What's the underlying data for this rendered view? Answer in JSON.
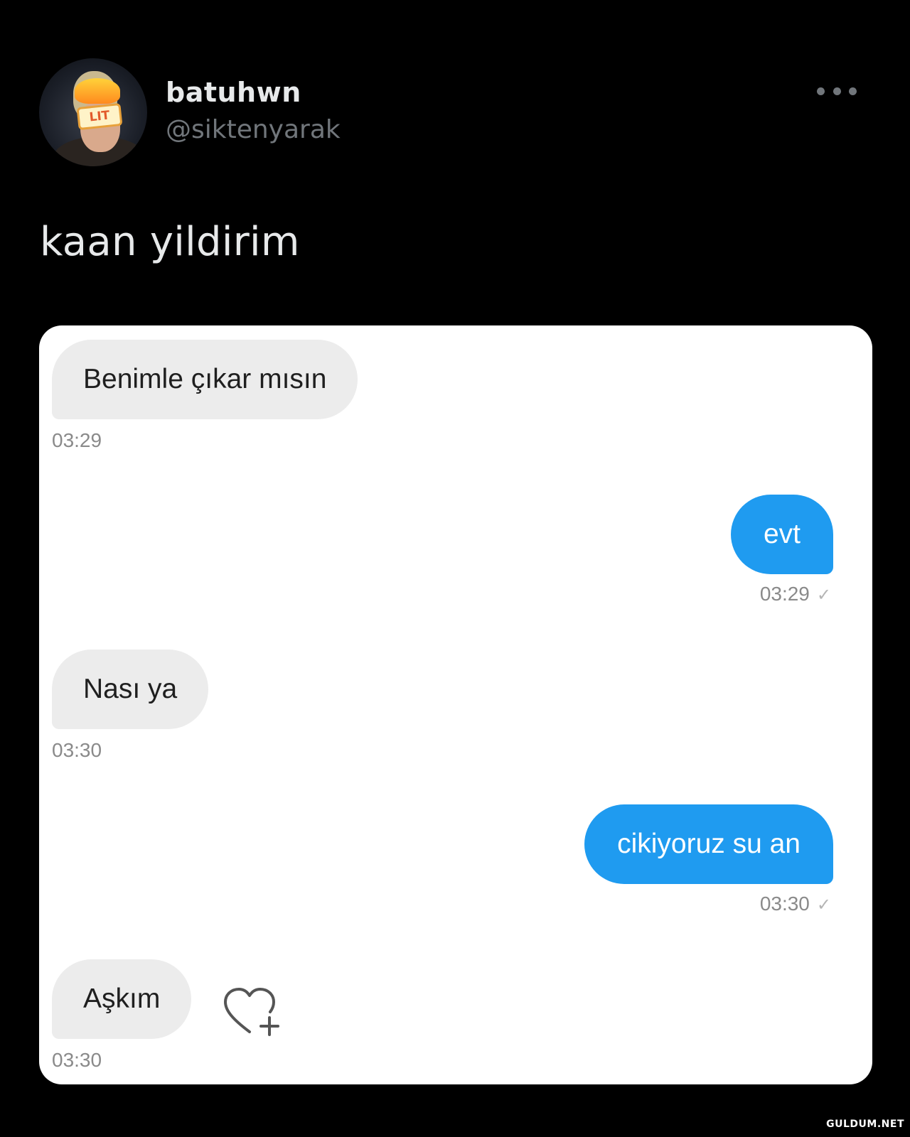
{
  "tweet": {
    "display_name": "batuhwn",
    "handle": "@siktenyarak",
    "text": "kaan yildirim",
    "avatar_badge": "LIT",
    "more_icon": "more-horizontal-icon"
  },
  "chat": {
    "messages": [
      {
        "direction": "incoming",
        "text": "Benimle çıkar mısın",
        "time": "03:29"
      },
      {
        "direction": "outgoing",
        "text": "evt",
        "time": "03:29",
        "status": "✓"
      },
      {
        "direction": "incoming",
        "text": "Nası ya",
        "time": "03:30"
      },
      {
        "direction": "outgoing",
        "text": "cikiyoruz su an",
        "time": "03:30",
        "status": "✓"
      },
      {
        "direction": "incoming",
        "text": "Aşkım",
        "time": "03:30"
      }
    ],
    "like_icon": "heart-plus-icon",
    "colors": {
      "incoming_bubble": "#ececec",
      "outgoing_bubble": "#1f9bf0"
    }
  },
  "watermark": "GULDUM.NET"
}
